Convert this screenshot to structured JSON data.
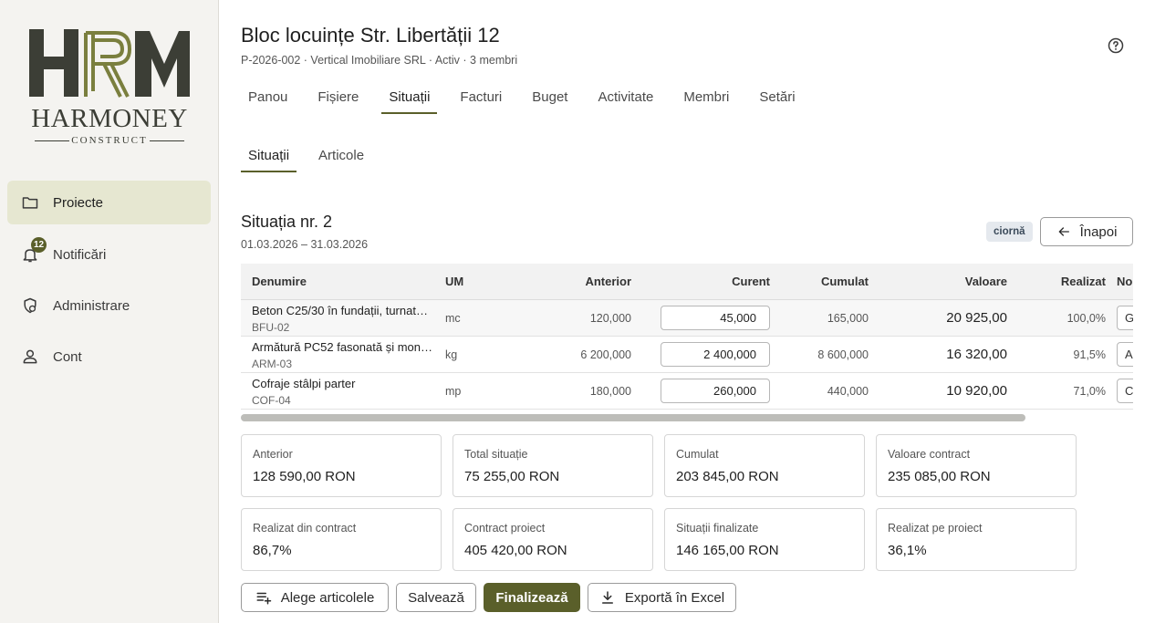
{
  "sidebar": {
    "logo": {
      "title": "HARMONEY",
      "subtitle": "CONSTRUCT",
      "mark": "HRM"
    },
    "items": [
      {
        "label": "Proiecte",
        "icon": "folder-icon",
        "active": true
      },
      {
        "label": "Notificări",
        "icon": "bell-icon",
        "badge": "12"
      },
      {
        "label": "Administrare",
        "icon": "admin-shield-icon"
      },
      {
        "label": "Cont",
        "icon": "person-icon"
      }
    ]
  },
  "header": {
    "title": "Bloc locuințe Str. Libertății 12",
    "subtitle": "P-2026-002 · Vertical Imobiliare SRL · Activ · 3 membri",
    "help_icon": "help-circle-icon"
  },
  "tabs": [
    "Panou",
    "Fișiere",
    "Situații",
    "Facturi",
    "Buget",
    "Activitate",
    "Membri",
    "Setări"
  ],
  "active_tab": "Situații",
  "subtabs": [
    "Situații",
    "Articole"
  ],
  "active_subtab": "Situații",
  "situatie": {
    "title": "Situația nr. 2",
    "dates": "01.03.2026 – 31.03.2026",
    "status": "ciornă",
    "back_label": "Înapoi"
  },
  "table": {
    "columns": {
      "name": "Denumire",
      "um": "UM",
      "anterior": "Anterior",
      "curent": "Curent",
      "cumulat": "Cumulat",
      "valoare": "Valoare",
      "realizat": "Realizat",
      "note": "No"
    },
    "rows": [
      {
        "name": "Beton C25/30 în fundații, turnat…",
        "code": "BFU-02",
        "um": "mc",
        "anterior": "120,000",
        "curent": "45,000",
        "cumulat": "165,000",
        "valoare": "20 925,00",
        "realizat": "100,0%",
        "note": "G"
      },
      {
        "name": "Armătură PC52 fasonată și mon…",
        "code": "ARM-03",
        "um": "kg",
        "anterior": "6 200,000",
        "curent": "2 400,000",
        "cumulat": "8 600,000",
        "valoare": "16 320,00",
        "realizat": "91,5%",
        "note": "A"
      },
      {
        "name": "Cofraje stâlpi parter",
        "code": "COF-04",
        "um": "mp",
        "anterior": "180,000",
        "curent": "260,000",
        "cumulat": "440,000",
        "valoare": "10 920,00",
        "realizat": "71,0%",
        "note": "C"
      }
    ]
  },
  "summary": [
    {
      "label": "Anterior",
      "value": "128 590,00 RON"
    },
    {
      "label": "Total situație",
      "value": "75 255,00 RON"
    },
    {
      "label": "Cumulat",
      "value": "203 845,00 RON"
    },
    {
      "label": "Valoare contract",
      "value": "235 085,00 RON"
    },
    {
      "label": "Realizat din contract",
      "value": "86,7%"
    },
    {
      "label": "Contract proiect",
      "value": "405 420,00 RON"
    },
    {
      "label": "Situații finalizate",
      "value": "146 165,00 RON"
    },
    {
      "label": "Realizat pe proiect",
      "value": "36,1%"
    }
  ],
  "actions": {
    "choose": "Alege articolele",
    "save": "Salvează",
    "finalize": "Finalizează",
    "export": "Exportă în Excel"
  },
  "colors": {
    "accent": "#5a5f2a",
    "active_nav_bg": "#e6e7d1",
    "status_chip_bg": "#e5e9ee"
  }
}
